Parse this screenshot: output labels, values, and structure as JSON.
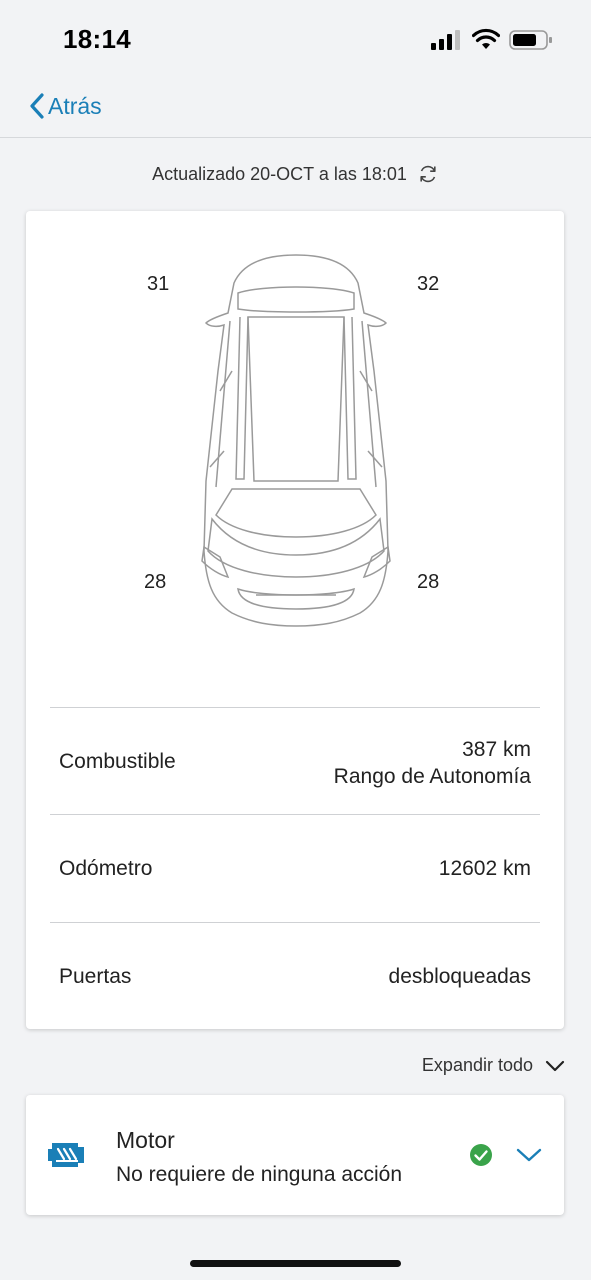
{
  "status_bar": {
    "time": "18:14",
    "icons": [
      "signal-icon",
      "wifi-icon",
      "battery-icon"
    ]
  },
  "nav": {
    "back_label": "Atrás",
    "accent_color": "#1a7fb7"
  },
  "updated": {
    "text": "Actualizado 20-OCT a las 18:01",
    "icon": "refresh-icon"
  },
  "tires": {
    "front_left": "31",
    "front_right": "32",
    "rear_left": "28",
    "rear_right": "28"
  },
  "info_rows": {
    "fuel": {
      "label": "Combustible",
      "value": "387 km",
      "value_sub": "Rango de Autonomía"
    },
    "odometer": {
      "label": "Odómetro",
      "value": "12602 km"
    },
    "doors": {
      "label": "Puertas",
      "value": "desbloqueadas"
    }
  },
  "expand": {
    "label": "Expandir todo",
    "icon": "chevron-down-icon"
  },
  "motor": {
    "title": "Motor",
    "subtitle": "No requiere de ninguna acción",
    "icon": "engine-icon",
    "status_icon": "check-circle-icon",
    "status_color": "#3aa34a",
    "brand_color": "#1a7fb7"
  }
}
